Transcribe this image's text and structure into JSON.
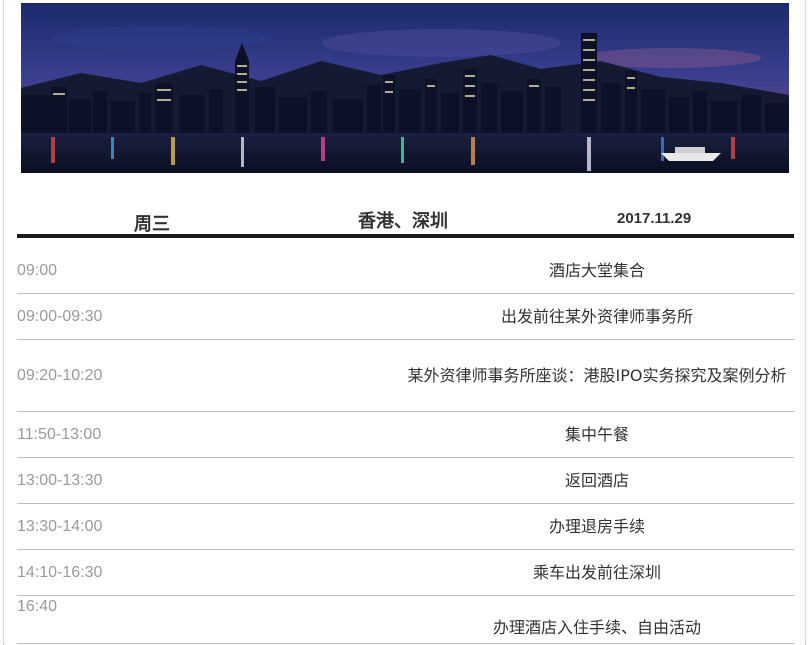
{
  "banner": {
    "description_icon": "city-skyline-image"
  },
  "header": {
    "weekday": "周三",
    "city": "香港、深圳",
    "date": "2017.11.29"
  },
  "schedule": [
    {
      "time": "09:00",
      "activity": "酒店大堂集合"
    },
    {
      "time": "09:00-09:30",
      "activity": "出发前往某外资律师事务所"
    },
    {
      "time": "09:20-10:20",
      "activity": "某外资律师事务所座谈：港股IPO实务探究及案例分析"
    },
    {
      "time": "11:50-13:00",
      "activity": "集中午餐"
    },
    {
      "time": "13:00-13:30",
      "activity": "返回酒店"
    },
    {
      "time": "13:30-14:00",
      "activity": "办理退房手续"
    },
    {
      "time": "14:10-16:30",
      "activity": "乘车出发前往深圳"
    },
    {
      "time": "16:40",
      "activity": "办理酒店入住手续、自由活动"
    }
  ],
  "colors": {
    "rule": "#1a1a1a",
    "divider": "#bfbfbf",
    "time_text": "#9a9a9a",
    "body_text": "#333333"
  }
}
